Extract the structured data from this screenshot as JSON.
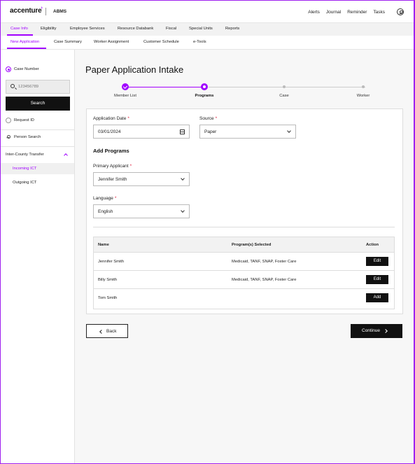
{
  "header": {
    "brand": "accenture",
    "app_name": "ABMS",
    "links": [
      "Alerts",
      "Journal",
      "Reminder",
      "Tasks"
    ],
    "user_icon": "user-circle-icon"
  },
  "nav_primary": {
    "items": [
      "Case Info",
      "Eligibility",
      "Employee Services",
      "Resource Databank",
      "Fiscal",
      "Special Units",
      "Reports"
    ],
    "active": "Case Info"
  },
  "nav_secondary": {
    "items": [
      "New Application",
      "Case Summary",
      "Worker Assignment",
      "Customer Schedule",
      "e-Tools"
    ],
    "active": "New Application"
  },
  "sidebar": {
    "case_number_label": "Case Number",
    "case_number_placeholder": "123456789",
    "search_label": "Search",
    "request_id_label": "Request ID",
    "person_search_label": "Person Search",
    "ict_label": "Inter-County Transfer",
    "incoming_ict": "Incoming ICT",
    "outgoing_ict": "Outgoing ICT"
  },
  "main": {
    "title": "Paper Application Intake",
    "steps": [
      {
        "label": "Member List",
        "state": "done"
      },
      {
        "label": "Programs",
        "state": "current"
      },
      {
        "label": "Case",
        "state": "todo"
      },
      {
        "label": "Worker",
        "state": "todo"
      }
    ],
    "form": {
      "application_date_label": "Application Date",
      "application_date_value": "03/01/2024",
      "source_label": "Source",
      "source_value": "Paper",
      "section_title": "Add Programs",
      "primary_applicant_label": "Primary Applicant",
      "primary_applicant_value": "Jennifer Smith",
      "language_label": "Language",
      "language_value": "English",
      "required_mark": "*"
    },
    "table": {
      "headers": [
        "Name",
        "Program(s) Selected",
        "Action"
      ],
      "rows": [
        {
          "name": "Jennifer Smith",
          "programs": "Medicaid, TANF, SNAP, Foster Care",
          "action": "Edit"
        },
        {
          "name": "Billy Smith",
          "programs": "Medicaid, TANF, SNAP, Foster Care",
          "action": "Edit"
        },
        {
          "name": "Tom Smith",
          "programs": "",
          "action": "Add"
        }
      ]
    },
    "back_label": "Back",
    "continue_label": "Continue"
  },
  "colors": {
    "accent": "#a100ff",
    "required": "#e01e3c",
    "button_dark": "#111111"
  }
}
